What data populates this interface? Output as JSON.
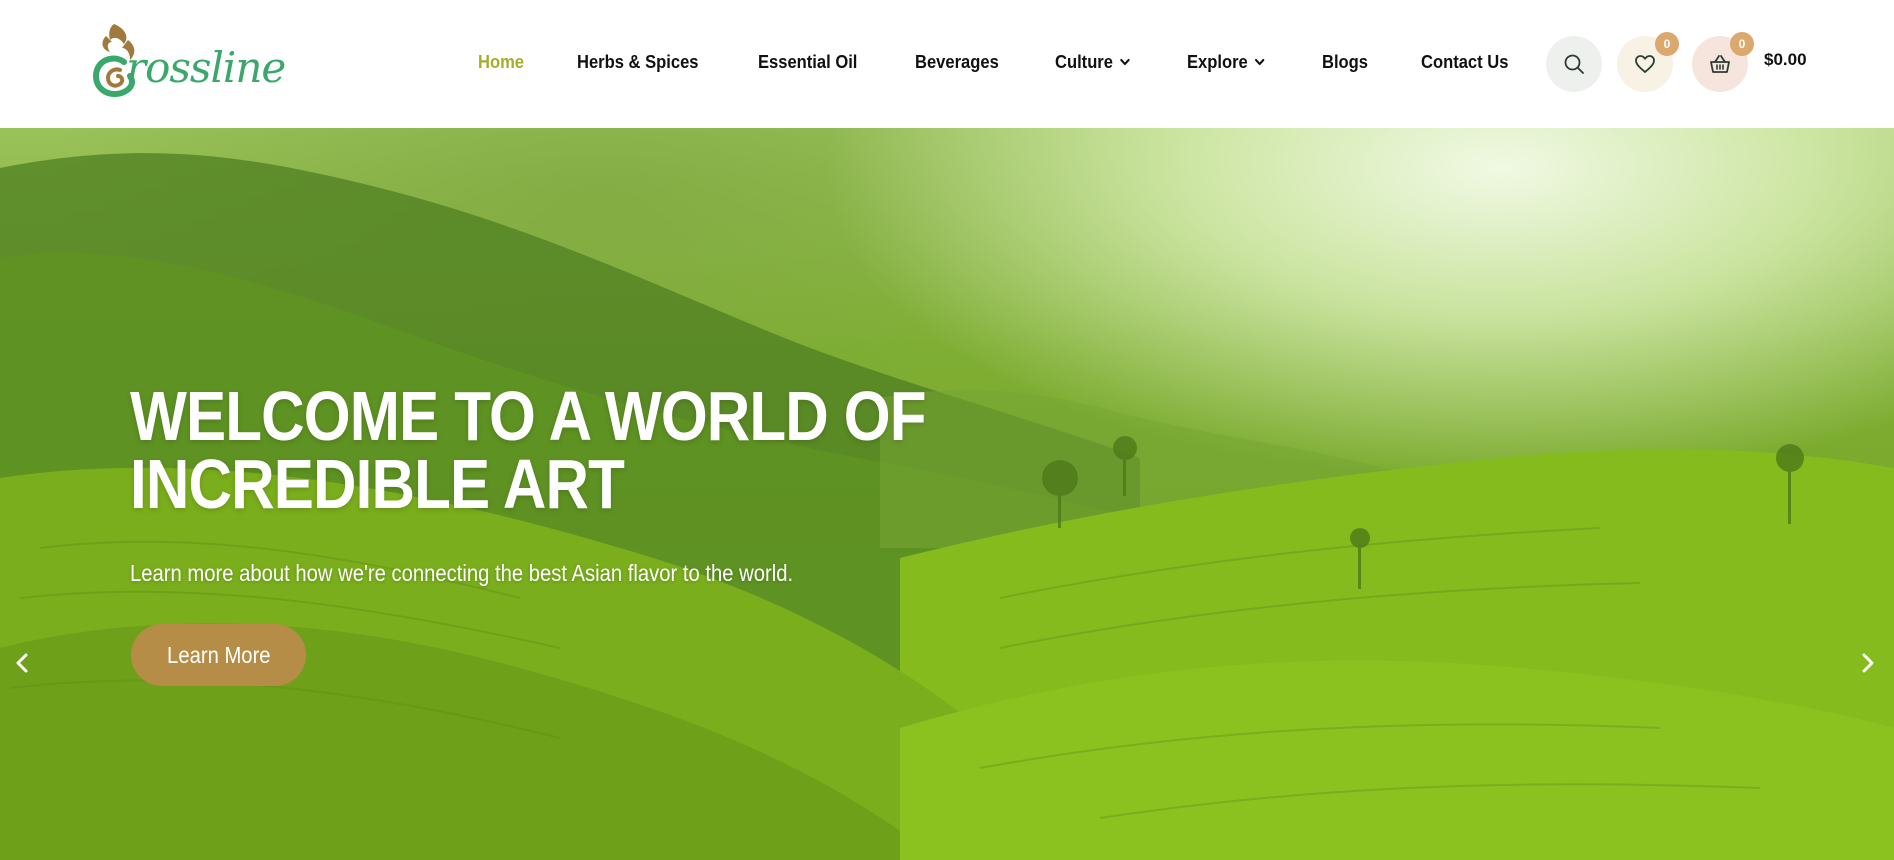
{
  "brand": {
    "logo_text": "rossline",
    "logo_color": "#3aa86b",
    "logo_mark_color": "#a07a3c"
  },
  "nav": {
    "items": [
      {
        "label": "Home",
        "active": true,
        "dropdown": false
      },
      {
        "label": "Herbs & Spices",
        "active": false,
        "dropdown": false
      },
      {
        "label": "Essential Oil",
        "active": false,
        "dropdown": false
      },
      {
        "label": "Beverages",
        "active": false,
        "dropdown": false
      },
      {
        "label": "Culture",
        "active": false,
        "dropdown": true
      },
      {
        "label": "Explore",
        "active": false,
        "dropdown": true
      },
      {
        "label": "Blogs",
        "active": false,
        "dropdown": false
      },
      {
        "label": "Contact Us",
        "active": false,
        "dropdown": false
      }
    ],
    "active_color": "#a3ae2c"
  },
  "header_actions": {
    "search_icon": "search-icon",
    "wishlist_icon": "heart-icon",
    "wishlist_count": "0",
    "cart_icon": "basket-icon",
    "cart_count": "0",
    "cart_total": "$0.00",
    "badge_color": "#dba86e"
  },
  "hero": {
    "title": "WELCOME TO A WORLD OF INCREDIBLE ART",
    "subtitle": "Learn more about how we're connecting the best Asian flavor to the world.",
    "cta_label": "Learn More",
    "cta_color": "#b68d46",
    "prev_icon": "chevron-left-icon",
    "next_icon": "chevron-right-icon"
  }
}
